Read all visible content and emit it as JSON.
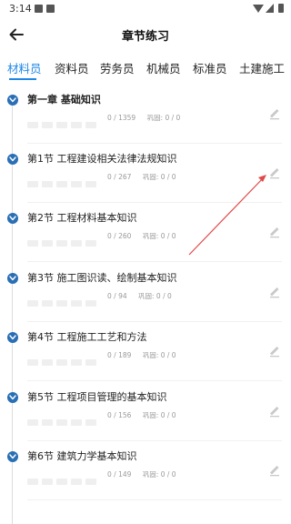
{
  "status": {
    "time": "3:14"
  },
  "header": {
    "title": "章节练习"
  },
  "tabs": [
    "材料员",
    "资料员",
    "劳务员",
    "机械员",
    "标准员",
    "土建施工"
  ],
  "chapters": [
    {
      "label": "第一章 基础知识",
      "progress": "0 / 1359",
      "review": "巩固: 0 / 0",
      "bold": true
    },
    {
      "label": "第1节 工程建设相关法律法规知识",
      "progress": "0 / 267",
      "review": "巩固: 0 / 0"
    },
    {
      "label": "第2节 工程材料基本知识",
      "progress": "0 / 260",
      "review": "巩固: 0 / 0"
    },
    {
      "label": "第3节 施工图识读、绘制基本知识",
      "progress": "0 / 94",
      "review": "巩固: 0 / 0"
    },
    {
      "label": "第4节 工程施工工艺和方法",
      "progress": "0 / 189",
      "review": "巩固: 0 / 0"
    },
    {
      "label": "第5节 工程项目管理的基本知识",
      "progress": "0 / 156",
      "review": "巩固: 0 / 0"
    },
    {
      "label": "第6节 建筑力学基本知识",
      "progress": "0 / 149",
      "review": "巩固: 0 / 0"
    }
  ],
  "colors": {
    "accent": "#1e88e5",
    "chapter_icon": "#2a6fb5",
    "annotation_arrow": "#e04a4a"
  },
  "icons": {
    "back": "arrow-left-icon",
    "expand": "chevron-down-icon",
    "edit": "pencil-icon"
  }
}
